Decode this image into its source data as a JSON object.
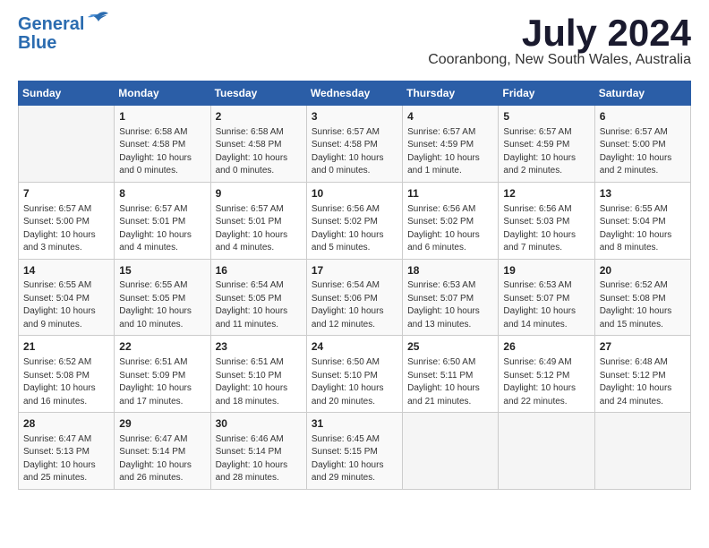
{
  "header": {
    "logo_line1": "General",
    "logo_line2": "Blue",
    "month": "July 2024",
    "location": "Cooranbong, New South Wales, Australia"
  },
  "days_of_week": [
    "Sunday",
    "Monday",
    "Tuesday",
    "Wednesday",
    "Thursday",
    "Friday",
    "Saturday"
  ],
  "weeks": [
    [
      {
        "day": "",
        "info": ""
      },
      {
        "day": "1",
        "info": "Sunrise: 6:58 AM\nSunset: 4:58 PM\nDaylight: 10 hours\nand 0 minutes."
      },
      {
        "day": "2",
        "info": "Sunrise: 6:58 AM\nSunset: 4:58 PM\nDaylight: 10 hours\nand 0 minutes."
      },
      {
        "day": "3",
        "info": "Sunrise: 6:57 AM\nSunset: 4:58 PM\nDaylight: 10 hours\nand 0 minutes."
      },
      {
        "day": "4",
        "info": "Sunrise: 6:57 AM\nSunset: 4:59 PM\nDaylight: 10 hours\nand 1 minute."
      },
      {
        "day": "5",
        "info": "Sunrise: 6:57 AM\nSunset: 4:59 PM\nDaylight: 10 hours\nand 2 minutes."
      },
      {
        "day": "6",
        "info": "Sunrise: 6:57 AM\nSunset: 5:00 PM\nDaylight: 10 hours\nand 2 minutes."
      }
    ],
    [
      {
        "day": "7",
        "info": "Sunrise: 6:57 AM\nSunset: 5:00 PM\nDaylight: 10 hours\nand 3 minutes."
      },
      {
        "day": "8",
        "info": "Sunrise: 6:57 AM\nSunset: 5:01 PM\nDaylight: 10 hours\nand 4 minutes."
      },
      {
        "day": "9",
        "info": "Sunrise: 6:57 AM\nSunset: 5:01 PM\nDaylight: 10 hours\nand 4 minutes."
      },
      {
        "day": "10",
        "info": "Sunrise: 6:56 AM\nSunset: 5:02 PM\nDaylight: 10 hours\nand 5 minutes."
      },
      {
        "day": "11",
        "info": "Sunrise: 6:56 AM\nSunset: 5:02 PM\nDaylight: 10 hours\nand 6 minutes."
      },
      {
        "day": "12",
        "info": "Sunrise: 6:56 AM\nSunset: 5:03 PM\nDaylight: 10 hours\nand 7 minutes."
      },
      {
        "day": "13",
        "info": "Sunrise: 6:55 AM\nSunset: 5:04 PM\nDaylight: 10 hours\nand 8 minutes."
      }
    ],
    [
      {
        "day": "14",
        "info": "Sunrise: 6:55 AM\nSunset: 5:04 PM\nDaylight: 10 hours\nand 9 minutes."
      },
      {
        "day": "15",
        "info": "Sunrise: 6:55 AM\nSunset: 5:05 PM\nDaylight: 10 hours\nand 10 minutes."
      },
      {
        "day": "16",
        "info": "Sunrise: 6:54 AM\nSunset: 5:05 PM\nDaylight: 10 hours\nand 11 minutes."
      },
      {
        "day": "17",
        "info": "Sunrise: 6:54 AM\nSunset: 5:06 PM\nDaylight: 10 hours\nand 12 minutes."
      },
      {
        "day": "18",
        "info": "Sunrise: 6:53 AM\nSunset: 5:07 PM\nDaylight: 10 hours\nand 13 minutes."
      },
      {
        "day": "19",
        "info": "Sunrise: 6:53 AM\nSunset: 5:07 PM\nDaylight: 10 hours\nand 14 minutes."
      },
      {
        "day": "20",
        "info": "Sunrise: 6:52 AM\nSunset: 5:08 PM\nDaylight: 10 hours\nand 15 minutes."
      }
    ],
    [
      {
        "day": "21",
        "info": "Sunrise: 6:52 AM\nSunset: 5:08 PM\nDaylight: 10 hours\nand 16 minutes."
      },
      {
        "day": "22",
        "info": "Sunrise: 6:51 AM\nSunset: 5:09 PM\nDaylight: 10 hours\nand 17 minutes."
      },
      {
        "day": "23",
        "info": "Sunrise: 6:51 AM\nSunset: 5:10 PM\nDaylight: 10 hours\nand 18 minutes."
      },
      {
        "day": "24",
        "info": "Sunrise: 6:50 AM\nSunset: 5:10 PM\nDaylight: 10 hours\nand 20 minutes."
      },
      {
        "day": "25",
        "info": "Sunrise: 6:50 AM\nSunset: 5:11 PM\nDaylight: 10 hours\nand 21 minutes."
      },
      {
        "day": "26",
        "info": "Sunrise: 6:49 AM\nSunset: 5:12 PM\nDaylight: 10 hours\nand 22 minutes."
      },
      {
        "day": "27",
        "info": "Sunrise: 6:48 AM\nSunset: 5:12 PM\nDaylight: 10 hours\nand 24 minutes."
      }
    ],
    [
      {
        "day": "28",
        "info": "Sunrise: 6:47 AM\nSunset: 5:13 PM\nDaylight: 10 hours\nand 25 minutes."
      },
      {
        "day": "29",
        "info": "Sunrise: 6:47 AM\nSunset: 5:14 PM\nDaylight: 10 hours\nand 26 minutes."
      },
      {
        "day": "30",
        "info": "Sunrise: 6:46 AM\nSunset: 5:14 PM\nDaylight: 10 hours\nand 28 minutes."
      },
      {
        "day": "31",
        "info": "Sunrise: 6:45 AM\nSunset: 5:15 PM\nDaylight: 10 hours\nand 29 minutes."
      },
      {
        "day": "",
        "info": ""
      },
      {
        "day": "",
        "info": ""
      },
      {
        "day": "",
        "info": ""
      }
    ]
  ]
}
